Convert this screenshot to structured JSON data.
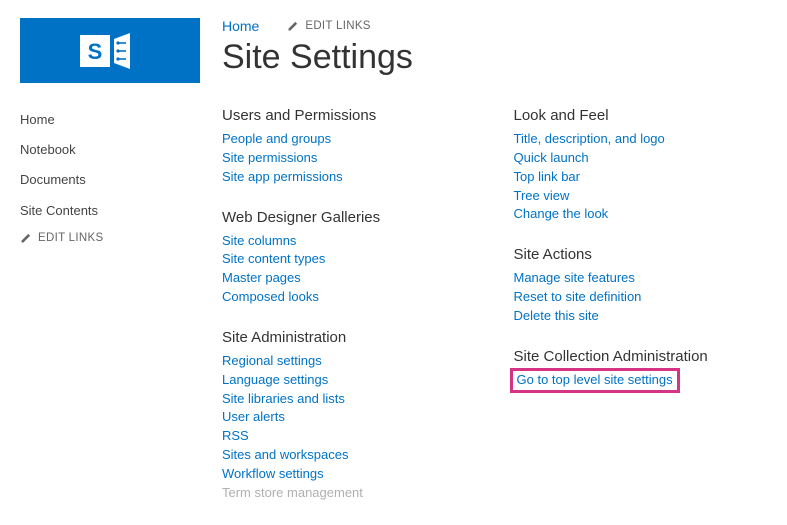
{
  "breadcrumb": {
    "home": "Home"
  },
  "edit_links_label": "EDIT LINKS",
  "page_title": "Site Settings",
  "left_nav": {
    "items": [
      {
        "label": "Home"
      },
      {
        "label": "Notebook"
      },
      {
        "label": "Documents"
      },
      {
        "label": "Site Contents"
      }
    ]
  },
  "col1": {
    "groups": [
      {
        "heading": "Users and Permissions",
        "links": [
          {
            "label": "People and groups"
          },
          {
            "label": "Site permissions"
          },
          {
            "label": "Site app permissions"
          }
        ]
      },
      {
        "heading": "Web Designer Galleries",
        "links": [
          {
            "label": "Site columns"
          },
          {
            "label": "Site content types"
          },
          {
            "label": "Master pages"
          },
          {
            "label": "Composed looks"
          }
        ]
      },
      {
        "heading": "Site Administration",
        "links": [
          {
            "label": "Regional settings"
          },
          {
            "label": "Language settings"
          },
          {
            "label": "Site libraries and lists"
          },
          {
            "label": "User alerts"
          },
          {
            "label": "RSS"
          },
          {
            "label": "Sites and workspaces"
          },
          {
            "label": "Workflow settings"
          },
          {
            "label": "Term store management",
            "disabled": true
          }
        ]
      }
    ]
  },
  "col2": {
    "groups": [
      {
        "heading": "Look and Feel",
        "links": [
          {
            "label": "Title, description, and logo"
          },
          {
            "label": "Quick launch"
          },
          {
            "label": "Top link bar"
          },
          {
            "label": "Tree view"
          },
          {
            "label": "Change the look"
          }
        ]
      },
      {
        "heading": "Site Actions",
        "links": [
          {
            "label": "Manage site features"
          },
          {
            "label": "Reset to site definition"
          },
          {
            "label": "Delete this site"
          }
        ]
      },
      {
        "heading": "Site Collection Administration",
        "links": [
          {
            "label": "Go to top level site settings",
            "highlight": true
          }
        ]
      }
    ]
  }
}
